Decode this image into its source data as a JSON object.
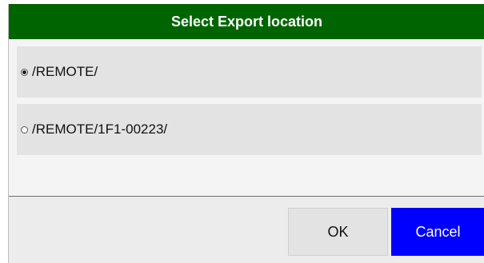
{
  "dialog": {
    "title": "Select Export location",
    "title_color": "#006400",
    "options": [
      {
        "label": "/REMOTE/",
        "selected": true
      },
      {
        "label": "/REMOTE/1F1-00223/",
        "selected": false
      }
    ],
    "ok_label": "OK",
    "cancel_label": "Cancel",
    "cancel_color": "#0000ff"
  }
}
